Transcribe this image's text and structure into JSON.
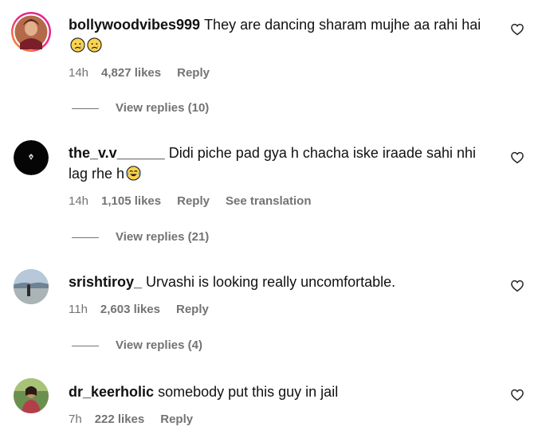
{
  "comments": [
    {
      "username": "bollywoodvibes999",
      "text": "They are dancing sharam mujhe aa rahi hai",
      "emoji": "😢😢",
      "time": "14h",
      "likes": "4,827 likes",
      "reply": "Reply",
      "translation": "",
      "view_replies": "View replies (10)"
    },
    {
      "username": "the_v.v______",
      "text": "Didi piche pad gya h chacha iske iraade sahi nhi lag rhe h",
      "emoji": "😂",
      "time": "14h",
      "likes": "1,105 likes",
      "reply": "Reply",
      "translation": "See translation",
      "view_replies": "View replies (21)"
    },
    {
      "username": "srishtiroy_",
      "text": "Urvashi is looking really uncomfortable.",
      "emoji": "",
      "time": "11h",
      "likes": "2,603 likes",
      "reply": "Reply",
      "translation": "",
      "view_replies": "View replies (4)"
    },
    {
      "username": "dr_keerholic",
      "text": "somebody put this guy in jail",
      "emoji": "",
      "time": "7h",
      "likes": "222 likes",
      "reply": "Reply",
      "translation": "",
      "view_replies": ""
    }
  ],
  "icons": {
    "like": "heart-outline-icon",
    "sad_emoji": "crying-face-emoji",
    "laugh_emoji": "tears-of-joy-emoji"
  },
  "colors": {
    "text": "#111111",
    "secondary": "#737373",
    "story_ring_start": "#f9a01e",
    "story_ring_end": "#d6249f"
  }
}
